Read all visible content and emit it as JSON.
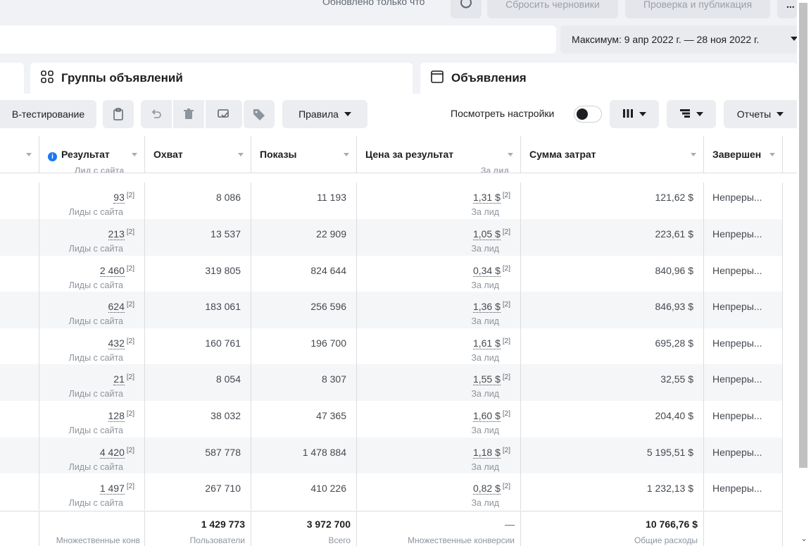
{
  "top": {
    "updated_text": "Обновлено только что",
    "reset_drafts": "Сбросить черновики",
    "review_publish": "Проверка и публикация",
    "more": "...",
    "date_range": "Максимум: 9 апр 2022 г. — 28 ноя 2022 г."
  },
  "tabs": [
    {
      "label": "Группы объявлений",
      "icon": "grid-icon"
    },
    {
      "label": "Объявления",
      "icon": "ad-frame-icon"
    }
  ],
  "toolbar": {
    "ab_testing": "B-тестирование",
    "rules": "Правила",
    "view_settings": "Посмотреть настройки",
    "reports": "Отчеты"
  },
  "columns": {
    "result": "Результат",
    "reach": "Охват",
    "impressions": "Показы",
    "cost_per_result": "Цена за результат",
    "spend": "Сумма затрат",
    "end": "Завершен",
    "result_sub": "Лид с сайта",
    "cost_sub": "За лид"
  },
  "rows": [
    {
      "result": "93",
      "result_sub": "Лиды с сайта",
      "reach": "8 086",
      "impressions": "11 193",
      "cost": "1,31 $",
      "cost_sub": "За лид",
      "spend": "121,62 $",
      "end": "Непреры..."
    },
    {
      "result": "213",
      "result_sub": "Лиды с сайта",
      "reach": "13 537",
      "impressions": "22 909",
      "cost": "1,05 $",
      "cost_sub": "За лид",
      "spend": "223,61 $",
      "end": "Непреры..."
    },
    {
      "result": "2 460",
      "result_sub": "Лиды с сайта",
      "reach": "319 805",
      "impressions": "824 644",
      "cost": "0,34 $",
      "cost_sub": "За лид",
      "spend": "840,96 $",
      "end": "Непреры..."
    },
    {
      "result": "624",
      "result_sub": "Лиды с сайта",
      "reach": "183 061",
      "impressions": "256 596",
      "cost": "1,36 $",
      "cost_sub": "За лид",
      "spend": "846,93 $",
      "end": "Непреры..."
    },
    {
      "result": "432",
      "result_sub": "Лиды с сайта",
      "reach": "160 761",
      "impressions": "196 700",
      "cost": "1,61 $",
      "cost_sub": "За лид",
      "spend": "695,28 $",
      "end": "Непреры..."
    },
    {
      "result": "21",
      "result_sub": "Лиды с сайта",
      "reach": "8 054",
      "impressions": "8 307",
      "cost": "1,55 $",
      "cost_sub": "За лид",
      "spend": "32,55 $",
      "end": "Непреры..."
    },
    {
      "result": "128",
      "result_sub": "Лиды с сайта",
      "reach": "38 032",
      "impressions": "47 365",
      "cost": "1,60 $",
      "cost_sub": "За лид",
      "spend": "204,40 $",
      "end": "Непреры..."
    },
    {
      "result": "4 420",
      "result_sub": "Лиды с сайта",
      "reach": "587 778",
      "impressions": "1 478 884",
      "cost": "1,18 $",
      "cost_sub": "За лид",
      "spend": "5 195,51 $",
      "end": "Непреры..."
    },
    {
      "result": "1 497",
      "result_sub": "Лиды с сайта",
      "reach": "267 710",
      "impressions": "410 226",
      "cost": "0,82 $",
      "cost_sub": "За лид",
      "spend": "1 232,13 $",
      "end": "Непреры..."
    }
  ],
  "footnote": "[2]",
  "totals": {
    "result_sub": "Множественные конв",
    "reach": "1 429 773",
    "reach_sub": "Пользователи",
    "impressions": "3 972 700",
    "impressions_sub": "Всего",
    "cost": "—",
    "cost_sub": "Множественные конверсии",
    "spend": "10 766,76 $",
    "spend_sub": "Общие расходы"
  }
}
